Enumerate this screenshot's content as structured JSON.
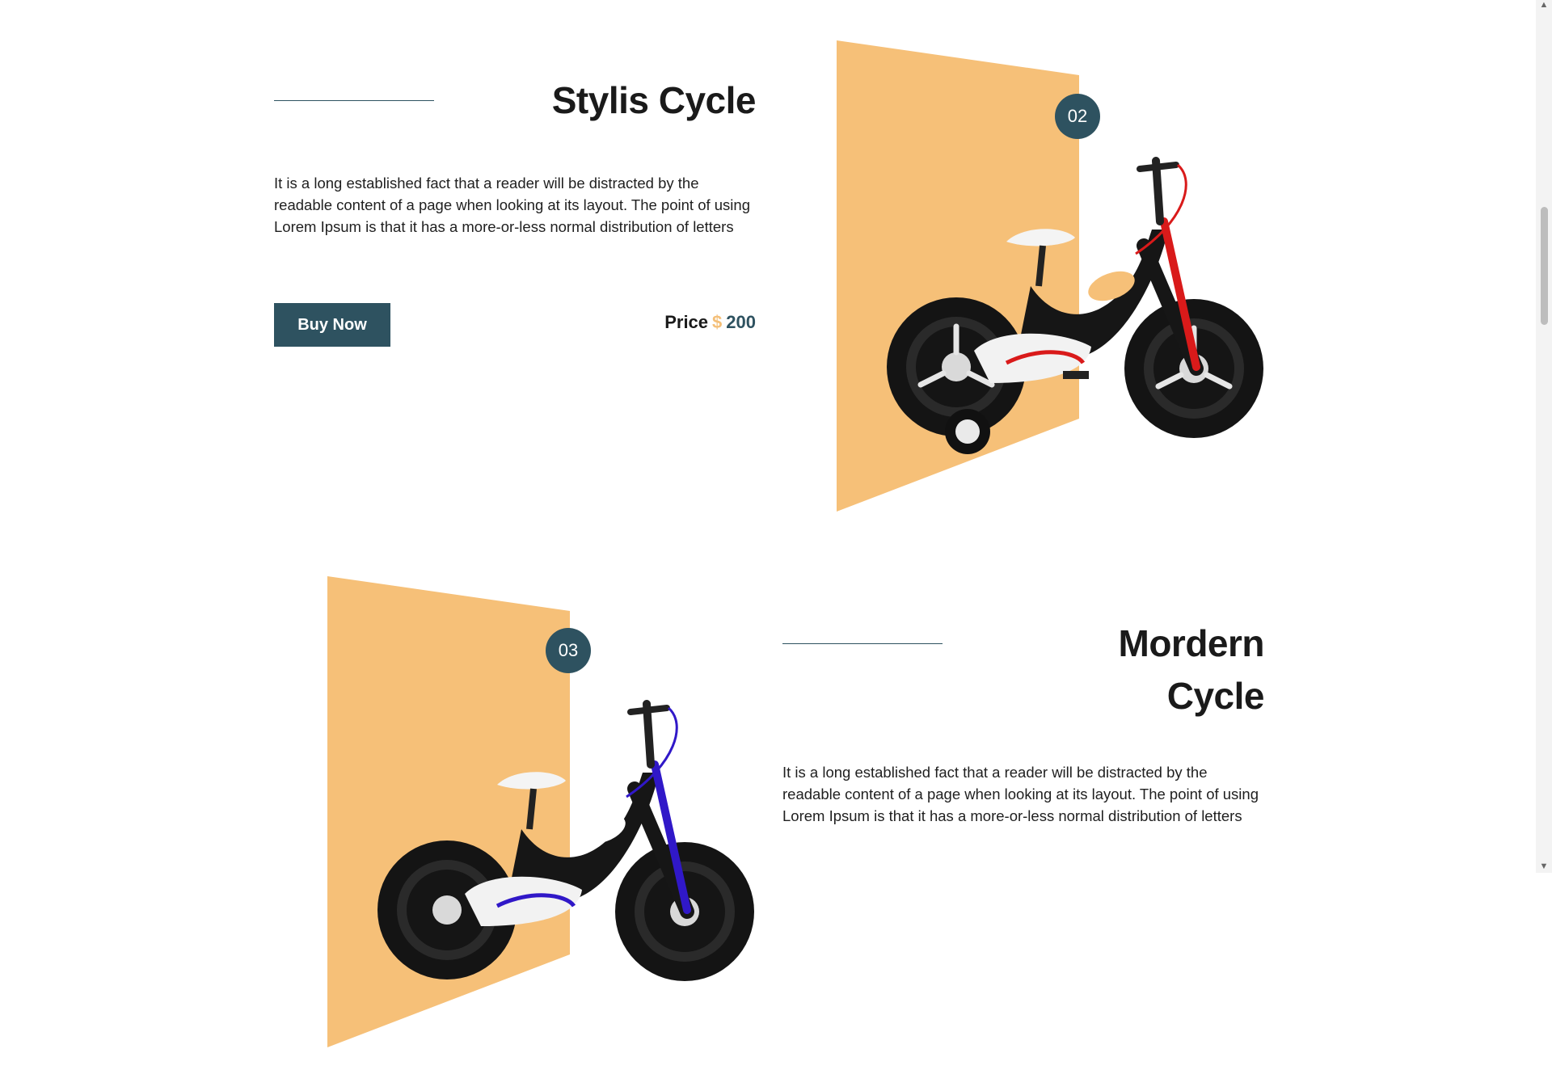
{
  "products": [
    {
      "id": "02",
      "badge": "02",
      "title": "Stylis Cycle",
      "description": "It is a long established fact that a reader will be distracted by the readable content of a page when looking at its layout. The point of using Lorem Ipsum is that it has a more-or-less normal distribution of letters",
      "button_label": "Buy Now",
      "price_label": "Price",
      "currency": "$",
      "price": "200",
      "accent_color": "#d91a1a"
    },
    {
      "id": "03",
      "badge": "03",
      "title": "Mordern Cycle",
      "description": "It is a long established fact that a reader will be distracted by the readable content of a page when looking at its layout. The point of using Lorem Ipsum is that it has a more-or-less normal distribution of letters",
      "accent_color": "#3018c8"
    }
  ],
  "colors": {
    "brand": "#2e5260",
    "panel": "#f6c078",
    "text": "#1a1a1a"
  },
  "icons": {
    "scroll_up": "▲",
    "scroll_down": "▼"
  }
}
